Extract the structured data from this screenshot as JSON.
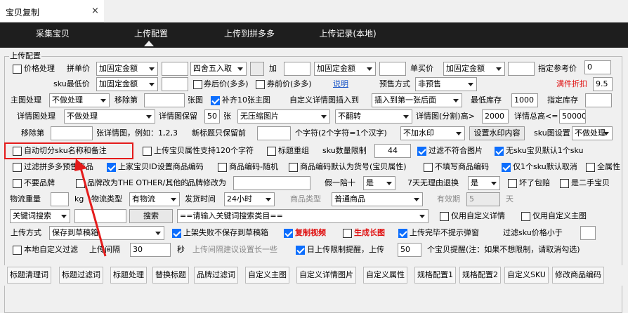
{
  "window": {
    "tab_title": "宝贝复制",
    "close": "×"
  },
  "topbar": {
    "items": [
      "采集宝贝",
      "上传配置",
      "上传到拼多多",
      "上传记录(本地)"
    ],
    "active_index": 1
  },
  "group": {
    "label": "上传配置"
  },
  "row1": {
    "price_process": "价格处理",
    "group_price": "拼单价",
    "group_mode": "加固定金额",
    "round_mode": "四舍五入取",
    "plus": "加",
    "single_mode": "加固定金额",
    "single_price": "单买价",
    "single_mode2": "加固定金额",
    "ref_price": "指定参考价",
    "ref_value": "0"
  },
  "row2": {
    "sku_min": "sku最低价",
    "sku_mode": "加固定金额",
    "after_coupon": "券后价(多多)",
    "before_coupon": "券前价(多多)",
    "explain": "说明",
    "presale": "预售方式",
    "presale_value": "非预售",
    "discount": "满件折扣",
    "discount_value": "9.5"
  },
  "row3": {
    "main_pic": "主图处理",
    "main_pic_value": "不做处理",
    "remove_nth": "移除第",
    "pic_unit": "张图",
    "fill10": "补齐10张主图",
    "custom_detail": "自定义详情图插入到",
    "insert_pos": "插入到第一张后面",
    "min_stock": "最低库存",
    "min_stock_value": "1000",
    "set_stock": "指定库存"
  },
  "row4": {
    "detail_pic": "详情图处理",
    "detail_value": "不做处理",
    "detail_limit": "详情图保留",
    "detail_count": "50",
    "zhang": "张",
    "compress": "无压缩图片",
    "flip": "不翻转",
    "split_height": "详情图(分割)高>",
    "split_value": "2000",
    "total_height": "详情总高<=",
    "total_value": "50000"
  },
  "row5": {
    "remove": "移除第",
    "remove_hint": "张详情图，例如：1,2,3",
    "title_keep": "新标题只保留前",
    "char_hint": "个字符(2个字符=1个汉字)",
    "watermark": "不加水印",
    "set_watermark": "设置水印内容",
    "sku_pic": "sku图设置",
    "sku_pic_value": "不做处理"
  },
  "row6": {
    "auto_split": "自动切分sku名称和备注",
    "attr120": "上传宝贝属性支持120个字符",
    "title_regroup": "标题重组",
    "sku_limit": "sku数量限制",
    "sku_limit_value": "44",
    "filter_pic": "过滤不符合图片",
    "no_sku": "无sku宝贝默认1个sku"
  },
  "row7": {
    "filter_pdd": "过滤拼多多预售产品",
    "set_code": "上家宝贝ID设置商品编码",
    "random_code": "商品编码-随机",
    "default_code": "商品编码默认为货号(宝贝属性)",
    "no_code": "不填写商品编码",
    "only_one": "仅1个sku默认取消",
    "full_attr": "全属性"
  },
  "row8": {
    "no_brand": "不要品牌",
    "brand_other": "品牌改为THE OTHER/其他的",
    "brand_modify": "品牌修改为",
    "fake_pay": "假一陪十",
    "fake_value": "是",
    "seven_days": "7天无理由退换",
    "seven_value": "是",
    "broken": "坏了包赔",
    "second_hand": "是二手宝贝"
  },
  "row9": {
    "weight": "物流重量",
    "kg": "kg",
    "ship_type": "物流类型",
    "ship_value": "有物流",
    "ship_time": "发货时间",
    "ship_time_value": "24小时",
    "goods_type": "商品类型",
    "goods_value": "普通商品",
    "valid": "有效期",
    "valid_value": "5",
    "day": "天"
  },
  "row10": {
    "keyword": "关键词搜索",
    "search": "搜索",
    "category": "==请输入关键词搜索类目==",
    "only_custom_detail": "仅用自定义详情",
    "only_custom_main": "仅用自定义主图"
  },
  "row11": {
    "upload_mode": "上传方式",
    "upload_value": "保存到草稿箱",
    "fail_draft": "上架失败不保存到草稿箱",
    "copy_video": "复制视频",
    "long_pic": "生成长图",
    "no_popup": "上传完毕不提示弹窗",
    "filter_sku": "过滤sku价格小于"
  },
  "row12": {
    "local_filter": "本地自定义过滤",
    "interval": "上传间隔",
    "interval_value": "30",
    "sec": "秒",
    "interval_hint": "上传间隔建议设置长一些",
    "daily_limit": "日上传限制提醒，上传",
    "daily_value": "50",
    "daily_hint": "个宝贝提醒(注：如果不想限制，请取消勾选)"
  },
  "bottom_tabs": [
    "标题清理词",
    "标题过滤词",
    "标题处理",
    "替换标题",
    "品牌过滤词",
    "自定义主图",
    "自定义详情图片",
    "自定义属性",
    "规格配置1",
    "规格配置2",
    "自定义SKU",
    "修改商品编码"
  ],
  "colors": {
    "topbar": "#1e1e1e",
    "callout": "#e41b1b",
    "checked": "#0d6efd",
    "red_text": "#e01010"
  }
}
